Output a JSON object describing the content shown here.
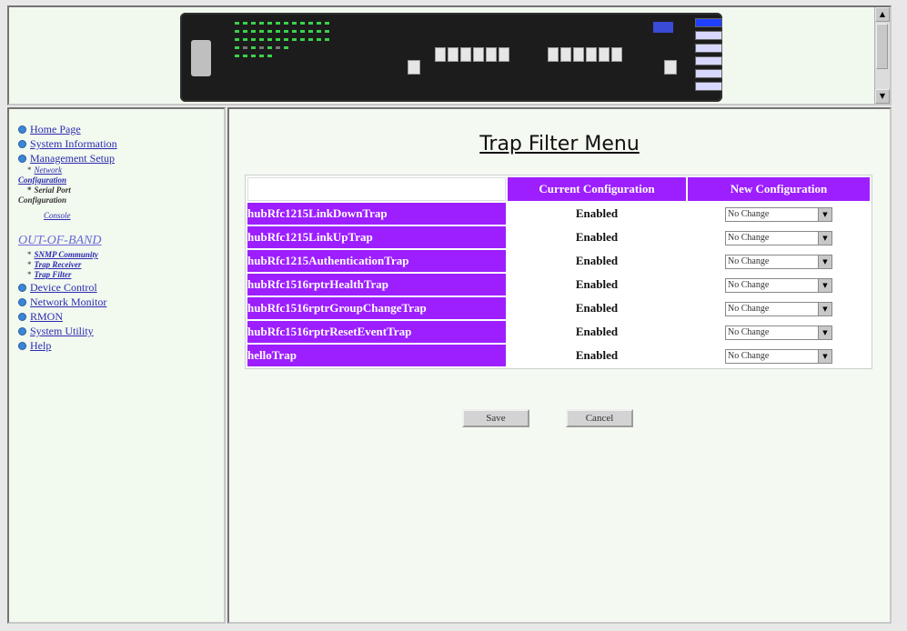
{
  "nav": {
    "items_top": [
      {
        "label": "Home Page"
      },
      {
        "label": "System Information"
      },
      {
        "label": "Management Setup"
      }
    ],
    "mgmt_sub": {
      "network_link": "Network",
      "network_rest": "Configuration",
      "serial_link": "Serial Port",
      "serial_rest": "Configuration",
      "console": "Console"
    },
    "oob_label": "OUT-OF-BAND",
    "oob_items": [
      "SNMP Community",
      "Trap Receiver",
      "Trap Filter"
    ],
    "items_bottom": [
      {
        "label": "Device Control"
      },
      {
        "label": "Network Monitor"
      },
      {
        "label": "RMON"
      },
      {
        "label": "System Utility"
      },
      {
        "label": "Help"
      }
    ]
  },
  "main": {
    "title": "Trap Filter Menu",
    "headers": {
      "current": "Current Configuration",
      "new": "New Configuration"
    },
    "rows": [
      {
        "name": "hubRfc1215LinkDownTrap",
        "current": "Enabled",
        "new": "No Change"
      },
      {
        "name": "hubRfc1215LinkUpTrap",
        "current": "Enabled",
        "new": "No Change"
      },
      {
        "name": "hubRfc1215AuthenticationTrap",
        "current": "Enabled",
        "new": "No Change"
      },
      {
        "name": "hubRfc1516rptrHealthTrap",
        "current": "Enabled",
        "new": "No Change"
      },
      {
        "name": "hubRfc1516rptrGroupChangeTrap",
        "current": "Enabled",
        "new": "No Change"
      },
      {
        "name": "hubRfc1516rptrResetEventTrap",
        "current": "Enabled",
        "new": "No Change"
      },
      {
        "name": "helloTrap",
        "current": "Enabled",
        "new": "No Change"
      }
    ],
    "save_label": "Save",
    "cancel_label": "Cancel"
  },
  "colors": {
    "accent_purple": "#9d1fff",
    "link_blue": "#2b2bb0",
    "bullet_blue": "#3c86d8"
  }
}
